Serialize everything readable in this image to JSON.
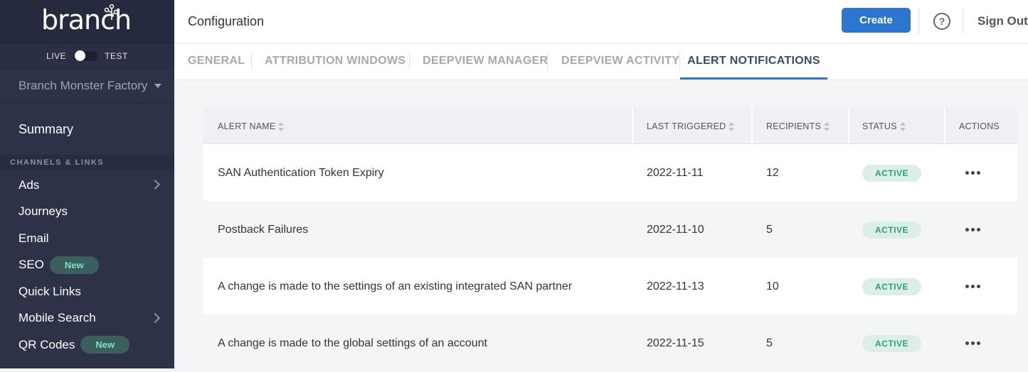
{
  "sidebar": {
    "logo_text": "branch",
    "env_live": "LIVE",
    "env_test": "TEST",
    "app_name": "Branch Monster Factory",
    "summary": "Summary",
    "section_heading": "CHANNELS & LINKS",
    "items": [
      {
        "label": "Ads",
        "has_chevron": true
      },
      {
        "label": "Journeys"
      },
      {
        "label": "Email"
      },
      {
        "label": "SEO",
        "badge": "New"
      },
      {
        "label": "Quick Links"
      },
      {
        "label": "Mobile Search",
        "has_chevron": true
      },
      {
        "label": "QR Codes",
        "badge": "New"
      }
    ]
  },
  "header": {
    "title": "Configuration",
    "create_label": "Create",
    "help_glyph": "?",
    "signout_label": "Sign Out"
  },
  "tabs": [
    {
      "label": "GENERAL",
      "active": false
    },
    {
      "label": "ATTRIBUTION WINDOWS",
      "active": false
    },
    {
      "label": "DEEPVIEW MANAGER",
      "active": false
    },
    {
      "label": "DEEPVIEW ACTIVITY",
      "active": false
    },
    {
      "label": "ALERT NOTIFICATIONS",
      "active": true
    }
  ],
  "table": {
    "columns": [
      "ALERT NAME",
      "LAST TRIGGERED",
      "RECIPIENTS",
      "STATUS",
      "ACTIONS"
    ],
    "rows": [
      {
        "name": "SAN Authentication Token Expiry",
        "last_triggered": "2022-11-11",
        "recipients": "12",
        "status": "ACTIVE"
      },
      {
        "name": "Postback Failures",
        "last_triggered": "2022-11-10",
        "recipients": "5",
        "status": "ACTIVE"
      },
      {
        "name": "A change is made to the settings of an existing integrated SAN partner",
        "last_triggered": "2022-11-13",
        "recipients": "10",
        "status": "ACTIVE"
      },
      {
        "name": "A change is made to the global settings of an account",
        "last_triggered": "2022-11-15",
        "recipients": "5",
        "status": "ACTIVE"
      }
    ]
  },
  "colors": {
    "sidebar_bg": "#2e3249",
    "accent": "#2d76d0",
    "status_active": "#2f9e78",
    "badge_new": "#7fe0c6"
  }
}
